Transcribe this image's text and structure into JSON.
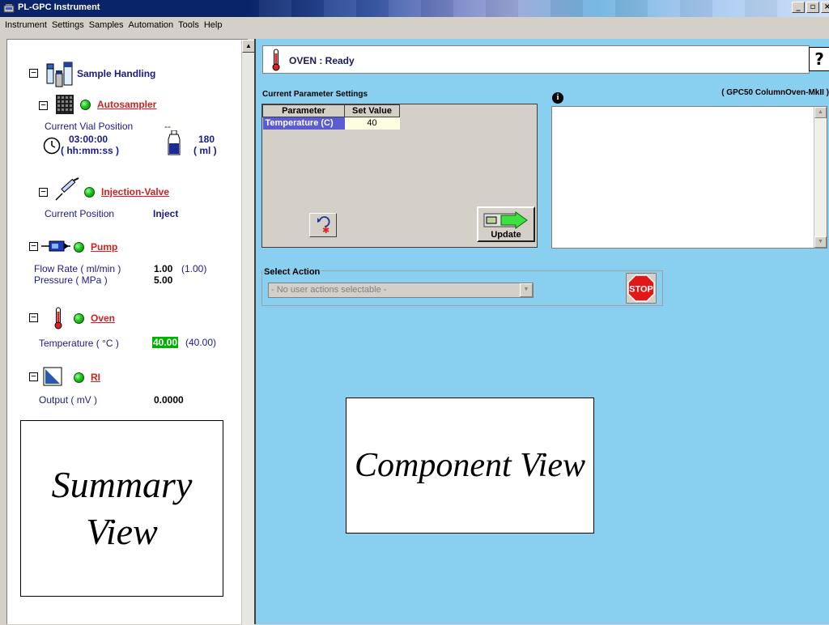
{
  "window": {
    "title": "PL-GPC Instrument",
    "buttons": [
      "_",
      "▫",
      "×"
    ]
  },
  "menu": [
    "Instrument",
    "Settings",
    "Samples",
    "Automation",
    "Tools",
    "Help"
  ],
  "summary": {
    "sample_handling": {
      "collapse": "−",
      "label": "Sample Handling"
    },
    "autosampler": {
      "collapse": "−",
      "label": "Autosampler",
      "status_color": "#1fc41f",
      "vial_position_label": "Current Vial Position",
      "vial_position_value": "--",
      "time_value": "03:00:00",
      "time_unit": "( hh:mm:ss )",
      "volume_value": "180",
      "volume_unit": "( ml )"
    },
    "injection_valve": {
      "collapse": "−",
      "label": "Injection-Valve",
      "status_color": "#1fc41f",
      "position_label": "Current Position",
      "position_value": "Inject"
    },
    "pump": {
      "collapse": "−",
      "label": "Pump",
      "status_color": "#1fc41f",
      "flow_label": "Flow Rate ( ml/min )",
      "flow_value": "1.00",
      "flow_setpoint": "(1.00)",
      "pressure_label": "Pressure ( MPa )",
      "pressure_value": "5.00"
    },
    "oven": {
      "collapse": "−",
      "label": "Oven",
      "status_color": "#1fc41f",
      "temp_label": "Temperature ( °C )",
      "temp_value": "40.00",
      "temp_setpoint": "(40.00)"
    },
    "ri": {
      "collapse": "−",
      "label": "RI",
      "status_color": "#1fc41f",
      "output_label": "Output ( mV )",
      "output_value": "0.0000"
    },
    "overlay_line1": "Summary",
    "overlay_line2": "View"
  },
  "component": {
    "status": "OVEN : Ready",
    "help": "?",
    "model": "( GPC50 ColumnOven-MkII )",
    "params_title": "Current Parameter Settings",
    "param_headers": [
      "Parameter",
      "Set Value"
    ],
    "params": [
      {
        "name": "Temperature (C)",
        "value": "40"
      }
    ],
    "update_label": "Update",
    "info_icon": "i",
    "action_title": "Select Action",
    "action_select": "- No user actions selectable -",
    "stop_label": "STOP",
    "overlay": "Component View"
  }
}
